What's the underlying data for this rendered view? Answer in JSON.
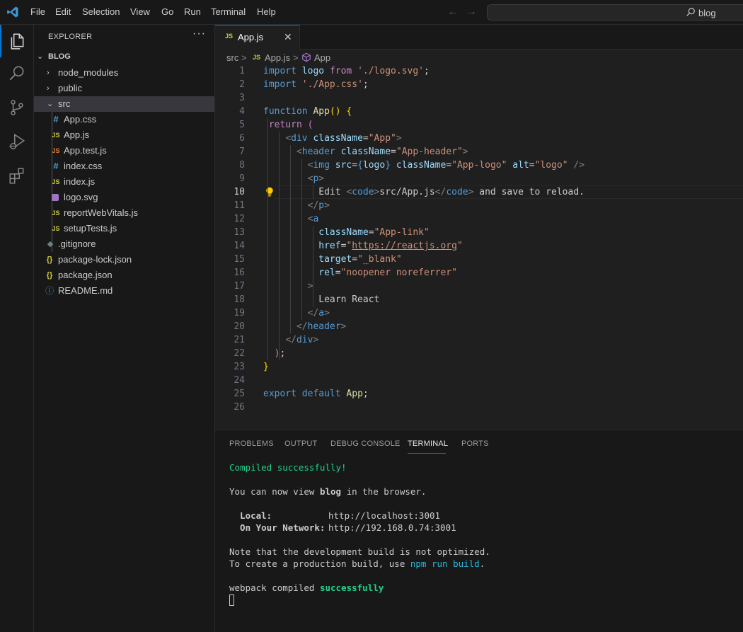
{
  "menu": [
    "File",
    "Edit",
    "Selection",
    "View",
    "Go",
    "Run",
    "Terminal",
    "Help"
  ],
  "search": {
    "text": "blog"
  },
  "explorer": {
    "title": "EXPLORER",
    "more": "···",
    "root": "BLOG",
    "items": [
      {
        "label": "node_modules",
        "icon": "chevron-right"
      },
      {
        "label": "public",
        "icon": "chevron-right"
      },
      {
        "label": "src",
        "icon": "chevron-down"
      },
      {
        "label": "App.css",
        "icon": "#"
      },
      {
        "label": "App.js",
        "icon": "JS"
      },
      {
        "label": "App.test.js",
        "icon": "JS"
      },
      {
        "label": "index.css",
        "icon": "#"
      },
      {
        "label": "index.js",
        "icon": "JS"
      },
      {
        "label": "logo.svg",
        "icon": "svg"
      },
      {
        "label": "reportWebVitals.js",
        "icon": "JS"
      },
      {
        "label": "setupTests.js",
        "icon": "JS"
      },
      {
        "label": ".gitignore",
        "icon": "◆"
      },
      {
        "label": "package-lock.json",
        "icon": "{}"
      },
      {
        "label": "package.json",
        "icon": "{}"
      },
      {
        "label": "README.md",
        "icon": "ⓘ"
      }
    ]
  },
  "tab": {
    "icon": "JS",
    "name": "App.js",
    "close": "✕"
  },
  "breadcrumb": {
    "folder": "src",
    "sep1": ">",
    "file_icon": "JS",
    "file": "App.js",
    "sep2": ">",
    "symbol": "App"
  },
  "editor": {
    "line_numbers": [
      "1",
      "2",
      "3",
      "4",
      "5",
      "6",
      "7",
      "8",
      "9",
      "10",
      "11",
      "12",
      "13",
      "14",
      "15",
      "16",
      "17",
      "18",
      "19",
      "20",
      "21",
      "22",
      "23",
      "24",
      "25",
      "26"
    ],
    "active_line": "10"
  },
  "panel": {
    "tabs": [
      "PROBLEMS",
      "OUTPUT",
      "DEBUG CONSOLE",
      "TERMINAL",
      "PORTS"
    ],
    "active_tab": "TERMINAL",
    "terminal": {
      "compiled": "Compiled successfully!",
      "view_prefix": "You can now view ",
      "app_name": "blog",
      "view_suffix": " in the browser.",
      "local_label": "  Local:",
      "local_url": "http://localhost:3001",
      "network_label": "  On Your Network:",
      "network_url": "http://192.168.0.74:3001",
      "note1": "Note that the development build is not optimized.",
      "note2_prefix": "To create a production build, use ",
      "note2_cmd": "npm run build",
      "note2_suffix": ".",
      "webpack_prefix": "webpack compiled ",
      "webpack_status": "successfully"
    }
  }
}
